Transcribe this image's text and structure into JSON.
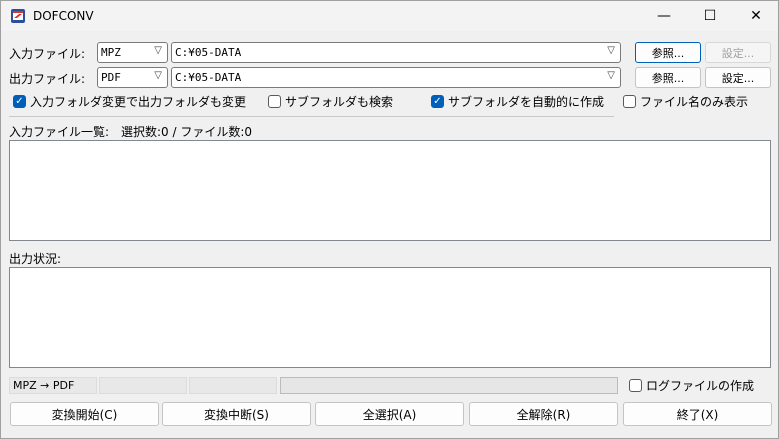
{
  "window": {
    "title": "DOFCONV",
    "minimize": "—",
    "maximize": "☐",
    "close": "✕"
  },
  "input": {
    "label": "入力ファイル:",
    "format": "MPZ",
    "path": "C:¥05-DATA",
    "browse": "参照...",
    "settings": "設定..."
  },
  "output": {
    "label": "出力ファイル:",
    "format": "PDF",
    "path": "C:¥05-DATA",
    "browse": "参照...",
    "settings": "設定..."
  },
  "options": {
    "sync_output_folder": {
      "label": "入力フォルダ変更で出力フォルダも変更",
      "checked": true
    },
    "search_subfolders": {
      "label": "サブフォルダも検索",
      "checked": false
    },
    "auto_create_subfolders": {
      "label": "サブフォルダを自動的に作成",
      "checked": true
    },
    "filename_only": {
      "label": "ファイル名のみ表示",
      "checked": false
    }
  },
  "file_list": {
    "label": "入力ファイル一覧:",
    "summary": "選択数:0 / ファイル数:0"
  },
  "output_status": {
    "label": "出力状況:"
  },
  "statusbar": {
    "conversion": "MPZ → PDF",
    "cell2": "",
    "cell3": "",
    "progress": 0
  },
  "log_option": {
    "label": "ログファイルの作成",
    "checked": false
  },
  "buttons": {
    "start": "変換開始(C)",
    "stop": "変換中断(S)",
    "select_all": "全選択(A)",
    "deselect_all": "全解除(R)",
    "exit": "終了(X)"
  }
}
